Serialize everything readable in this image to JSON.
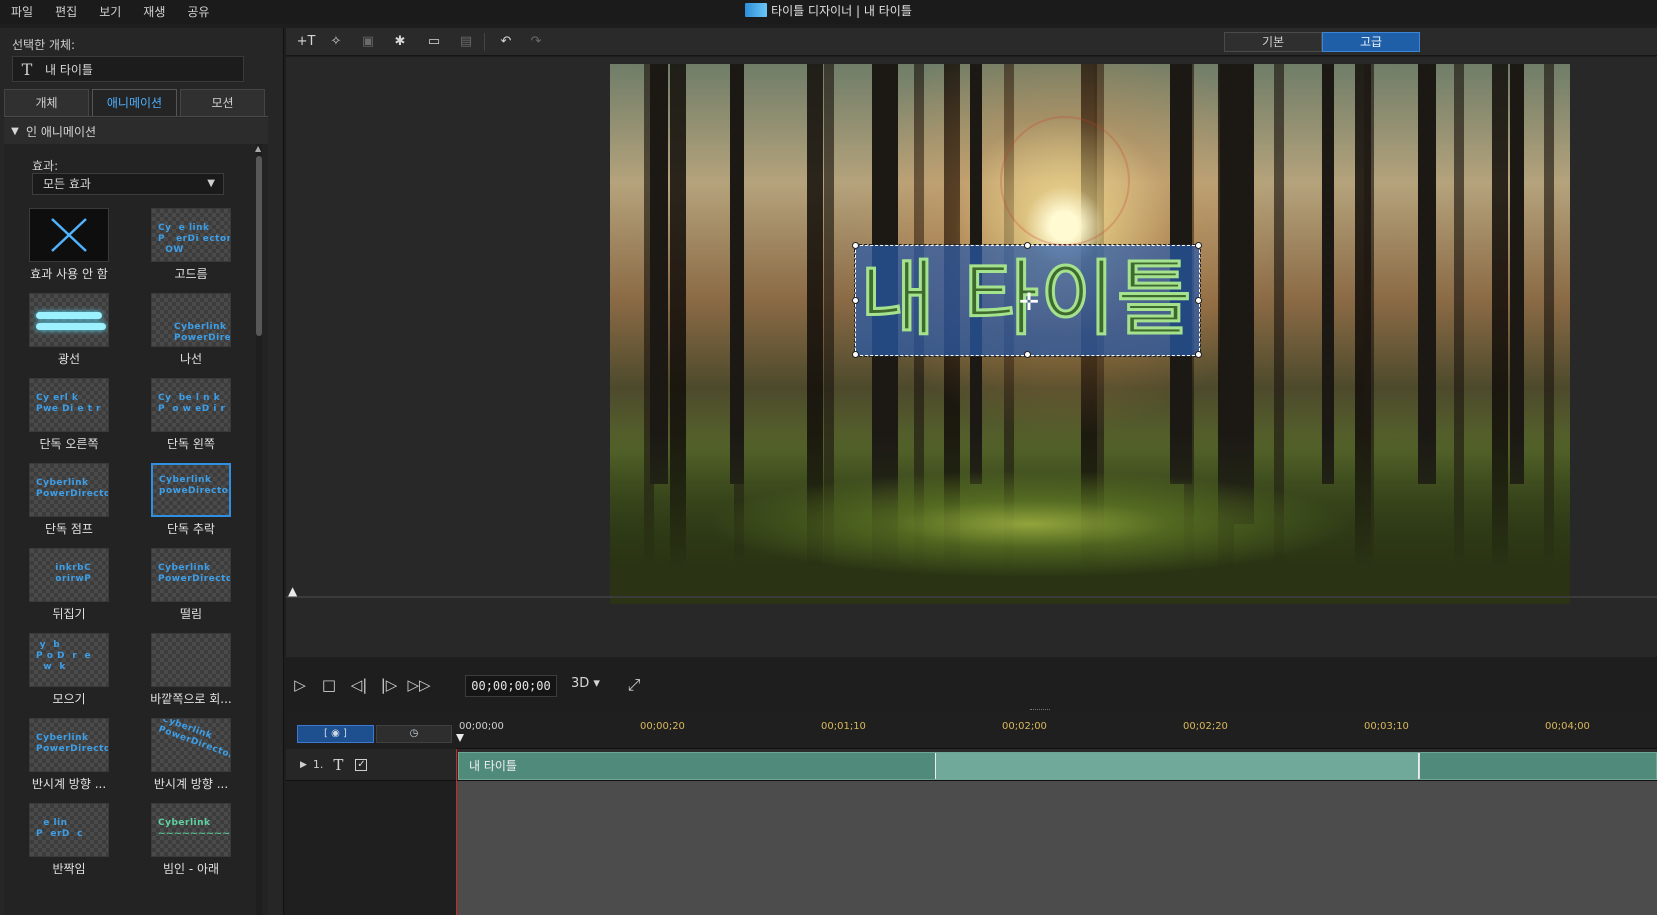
{
  "menu": [
    "파일",
    "편집",
    "보기",
    "재생",
    "공유"
  ],
  "window_title": "타이틀 디자이너  |  내 타이틀",
  "left": {
    "selected_label": "선택한 개체:",
    "selected_name": "내 타이틀",
    "tabs": [
      {
        "label": "개체",
        "active": false
      },
      {
        "label": "애니메이션",
        "active": true
      },
      {
        "label": "모션",
        "active": false
      }
    ],
    "section": "인 애니메이션",
    "effect_label": "효과:",
    "effect_value": "모든 효과",
    "effects": [
      {
        "label": "효과 사용 안 함",
        "thumb": "none"
      },
      {
        "label": "고드름",
        "thumb": "Cy  e link\nP   erDi ector\n  OW"
      },
      {
        "label": "광선",
        "thumb": "glow"
      },
      {
        "label": "나선",
        "thumb": "Cyberlink\nPowerDirecto"
      },
      {
        "label": "단독 오른쪽",
        "thumb": "Cy erl k\nPwe Di e t r"
      },
      {
        "label": "단독 왼쪽",
        "thumb": "Cy  be l n k\nP  o w eD i r  t  or"
      },
      {
        "label": "단독 점프",
        "thumb": "Cyberlink\nPowerDirector"
      },
      {
        "label": "단독 추락",
        "thumb": "Cyberlink\npoweDirector",
        "selected": true
      },
      {
        "label": "뒤집기",
        "thumb": "  inkrbC\n  orirwP"
      },
      {
        "label": "떨림",
        "thumb": "Cyberlink\nPowerDirector"
      },
      {
        "label": "모으기",
        "thumb": " y  b  \nP o D  r  e\n  w  k  "
      },
      {
        "label": "바깥쪽으로 회...",
        "thumb": ""
      },
      {
        "label": "반시계 방향 ...",
        "thumb": "Cyberlink\nPowerDirector"
      },
      {
        "label": "반시계 방향 ...",
        "thumb": "Cyberlink\nPowerDirector"
      },
      {
        "label": "반짝임",
        "thumb": "  e lin\nP  erD  c"
      },
      {
        "label": "빔인 - 아래",
        "thumb": "Cyberlink\n~~~~~~~~~"
      }
    ]
  },
  "toolbar": {
    "icons": [
      "insert-text-icon",
      "insert-particle-icon",
      "insert-image-icon",
      "insert-effect-icon",
      "insert-background-icon",
      "delete-icon",
      "undo-icon",
      "redo-icon"
    ],
    "modes": [
      {
        "label": "기본",
        "active": false
      },
      {
        "label": "고급",
        "active": true
      }
    ]
  },
  "preview": {
    "title_text": "내 타이틀",
    "accent": "#2f8fe0"
  },
  "transport": {
    "timecode": "00;00;00;00",
    "mode": "3D ▾"
  },
  "timeline": {
    "ticks": [
      "00;00;00",
      "00;00;20",
      "00;01;10",
      "00;02;00",
      "00;02;20",
      "00;03;10",
      "00;04;00"
    ],
    "track": {
      "index": "1.",
      "clip_label": "내 타이틀"
    }
  }
}
